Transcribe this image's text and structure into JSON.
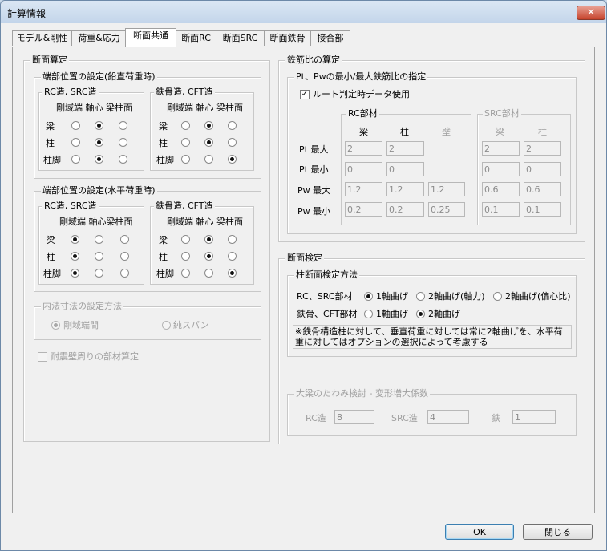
{
  "window": {
    "title": "計算情報",
    "close_symbol": "✕"
  },
  "tabs": [
    {
      "label": "モデル&剛性"
    },
    {
      "label": "荷重&応力"
    },
    {
      "label": "断面共通"
    },
    {
      "label": "断面RC"
    },
    {
      "label": "断面SRC"
    },
    {
      "label": "断面鉄骨"
    },
    {
      "label": "接合部"
    }
  ],
  "active_tab": "断面共通",
  "section_calc": {
    "title": "断面算定",
    "vertical": {
      "title": "端部位置の設定(鉛直荷重時)",
      "rc": {
        "title": "RC造, SRC造",
        "columns": "剛域端 軸心 梁柱面",
        "rows": [
          {
            "label": "梁",
            "selected": 1
          },
          {
            "label": "柱",
            "selected": 1
          },
          {
            "label": "柱脚",
            "selected": 1
          }
        ]
      },
      "steel": {
        "title": "鉄骨造, CFT造",
        "columns": "剛域端 軸心 梁柱面",
        "rows": [
          {
            "label": "梁",
            "selected": 1
          },
          {
            "label": "柱",
            "selected": 1
          },
          {
            "label": "柱脚",
            "selected": 2
          }
        ]
      }
    },
    "horizontal": {
      "title": "端部位置の設定(水平荷重時)",
      "rc": {
        "title": "RC造, SRC造",
        "columns": "剛域端 軸心梁柱面",
        "rows": [
          {
            "label": "梁",
            "selected": 0
          },
          {
            "label": "柱",
            "selected": 0
          },
          {
            "label": "柱脚",
            "selected": 0
          }
        ]
      },
      "steel": {
        "title": "鉄骨造, CFT造",
        "columns": "剛域端 軸心 梁柱面",
        "rows": [
          {
            "label": "梁",
            "selected": 1
          },
          {
            "label": "柱",
            "selected": 1
          },
          {
            "label": "柱脚",
            "selected": 2
          }
        ]
      }
    },
    "span": {
      "title": "内法寸法の設定方法",
      "option_rigid": "剛域端間",
      "option_clear": "純スパン",
      "selected": "剛域端間"
    },
    "seismic_wall_check": {
      "label": "耐震壁周りの部材算定",
      "checked": false
    }
  },
  "rebar_ratio": {
    "title": "鉄筋比の算定",
    "spec": {
      "title": "Pt、Pwの最小/最大鉄筋比の指定",
      "route_check": {
        "label": "ルート判定時データ使用",
        "checked": true,
        "mark": "✓"
      },
      "rc": {
        "title": "RC部材",
        "cols": [
          "梁",
          "柱",
          "壁"
        ]
      },
      "src": {
        "title": "SRC部材",
        "cols": [
          "梁",
          "柱"
        ]
      },
      "rows": [
        {
          "label": "Pt 最大",
          "rc": [
            "2",
            "2",
            ""
          ],
          "src": [
            "2",
            "2"
          ]
        },
        {
          "label": "Pt 最小",
          "rc": [
            "0",
            "0",
            ""
          ],
          "src": [
            "0",
            "0"
          ]
        },
        {
          "label": "Pw 最大",
          "rc": [
            "1.2",
            "1.2",
            "1.2"
          ],
          "src": [
            "0.6",
            "0.6"
          ]
        },
        {
          "label": "Pw 最小",
          "rc": [
            "0.2",
            "0.2",
            "0.25"
          ],
          "src": [
            "0.1",
            "0.1"
          ]
        }
      ]
    }
  },
  "section_check": {
    "title": "断面検定",
    "column_method": {
      "title": "柱断面検定方法",
      "rc_label": "RC、SRC部材",
      "rc_options": [
        "1軸曲げ",
        "2軸曲げ(軸力)",
        "2軸曲げ(偏心比)"
      ],
      "rc_selected": 0,
      "steel_label": "鉄骨、CFT部材",
      "steel_options": [
        "1軸曲げ",
        "2軸曲げ"
      ],
      "steel_selected": 1,
      "note": "※鉄骨構造柱に対して、垂直荷重に対しては常に2軸曲げを、水平荷重に対してはオプションの選択によって考慮する"
    },
    "deflection": {
      "title": "大梁のたわみ検討 - 変形増大係数",
      "rc_label": "RC造",
      "rc_value": "8",
      "src_label": "SRC造",
      "src_value": "4",
      "steel_label": "鉄",
      "steel_value": "1"
    }
  },
  "footer": {
    "ok_label": "OK",
    "close_label": "閉じる"
  }
}
